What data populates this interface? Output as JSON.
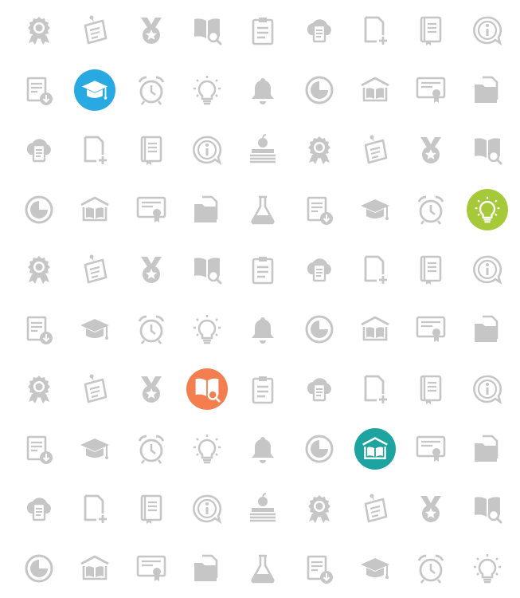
{
  "colors": {
    "icon_gray": "#c6c6c6",
    "badge_blue": "#29a9e1",
    "badge_green": "#a6c93a",
    "badge_orange": "#f47e4f",
    "badge_teal": "#1ea4a0"
  },
  "rows": [
    [
      {
        "icon": "award-rosette-icon"
      },
      {
        "icon": "pinned-note-icon"
      },
      {
        "icon": "medal-icon"
      },
      {
        "icon": "book-search-icon"
      },
      {
        "icon": "clipboard-icon"
      },
      {
        "icon": "cloud-document-icon"
      },
      {
        "icon": "new-document-icon"
      },
      {
        "icon": "book-icon"
      },
      {
        "icon": "info-bubble-icon"
      }
    ],
    [
      {
        "icon": "document-download-icon"
      },
      {
        "icon": "graduation-cap-icon",
        "badge": "badge_blue"
      },
      {
        "icon": "alarm-clock-icon"
      },
      {
        "icon": "lightbulb-icon"
      },
      {
        "icon": "bell-icon"
      },
      {
        "icon": "pie-chart-icon"
      },
      {
        "icon": "library-icon"
      },
      {
        "icon": "certificate-icon"
      },
      {
        "icon": "folder-icon"
      }
    ],
    [
      {
        "icon": "cloud-document-icon"
      },
      {
        "icon": "new-document-icon"
      },
      {
        "icon": "book-icon"
      },
      {
        "icon": "info-bubble-icon"
      },
      {
        "icon": "apple-books-icon"
      },
      {
        "icon": "award-rosette-icon"
      },
      {
        "icon": "pinned-note-icon"
      },
      {
        "icon": "medal-icon"
      },
      {
        "icon": "book-search-icon"
      }
    ],
    [
      {
        "icon": "pie-chart-icon"
      },
      {
        "icon": "library-icon"
      },
      {
        "icon": "certificate-icon"
      },
      {
        "icon": "folder-icon"
      },
      {
        "icon": "flask-icon"
      },
      {
        "icon": "document-download-icon"
      },
      {
        "icon": "graduation-cap-icon"
      },
      {
        "icon": "alarm-clock-icon"
      },
      {
        "icon": "lightbulb-icon",
        "badge": "badge_green"
      }
    ],
    [
      {
        "icon": "award-rosette-icon"
      },
      {
        "icon": "pinned-note-icon"
      },
      {
        "icon": "medal-icon"
      },
      {
        "icon": "book-search-icon"
      },
      {
        "icon": "clipboard-icon"
      },
      {
        "icon": "cloud-document-icon"
      },
      {
        "icon": "new-document-icon"
      },
      {
        "icon": "book-icon"
      },
      {
        "icon": "info-bubble-icon"
      }
    ],
    [
      {
        "icon": "document-download-icon"
      },
      {
        "icon": "graduation-cap-icon"
      },
      {
        "icon": "alarm-clock-icon"
      },
      {
        "icon": "lightbulb-icon"
      },
      {
        "icon": "bell-icon"
      },
      {
        "icon": "pie-chart-icon"
      },
      {
        "icon": "library-icon"
      },
      {
        "icon": "certificate-icon"
      },
      {
        "icon": "folder-icon"
      }
    ],
    [
      {
        "icon": "award-rosette-icon"
      },
      {
        "icon": "pinned-note-icon"
      },
      {
        "icon": "medal-icon"
      },
      {
        "icon": "book-search-icon",
        "badge": "badge_orange"
      },
      {
        "icon": "clipboard-icon"
      },
      {
        "icon": "cloud-document-icon"
      },
      {
        "icon": "new-document-icon"
      },
      {
        "icon": "book-icon"
      },
      {
        "icon": "info-bubble-icon"
      }
    ],
    [
      {
        "icon": "document-download-icon"
      },
      {
        "icon": "graduation-cap-icon"
      },
      {
        "icon": "alarm-clock-icon"
      },
      {
        "icon": "lightbulb-icon"
      },
      {
        "icon": "bell-icon"
      },
      {
        "icon": "pie-chart-icon"
      },
      {
        "icon": "library-icon",
        "badge": "badge_teal"
      },
      {
        "icon": "certificate-icon"
      },
      {
        "icon": "folder-icon"
      }
    ],
    [
      {
        "icon": "cloud-document-icon"
      },
      {
        "icon": "new-document-icon"
      },
      {
        "icon": "book-icon"
      },
      {
        "icon": "info-bubble-icon"
      },
      {
        "icon": "apple-books-icon"
      },
      {
        "icon": "award-rosette-icon"
      },
      {
        "icon": "pinned-note-icon"
      },
      {
        "icon": "medal-icon"
      },
      {
        "icon": "book-search-icon"
      }
    ],
    [
      {
        "icon": "pie-chart-icon"
      },
      {
        "icon": "library-icon"
      },
      {
        "icon": "certificate-icon"
      },
      {
        "icon": "folder-icon"
      },
      {
        "icon": "flask-icon"
      },
      {
        "icon": "document-download-icon"
      },
      {
        "icon": "graduation-cap-icon"
      },
      {
        "icon": "alarm-clock-icon"
      },
      {
        "icon": "lightbulb-icon"
      }
    ]
  ]
}
